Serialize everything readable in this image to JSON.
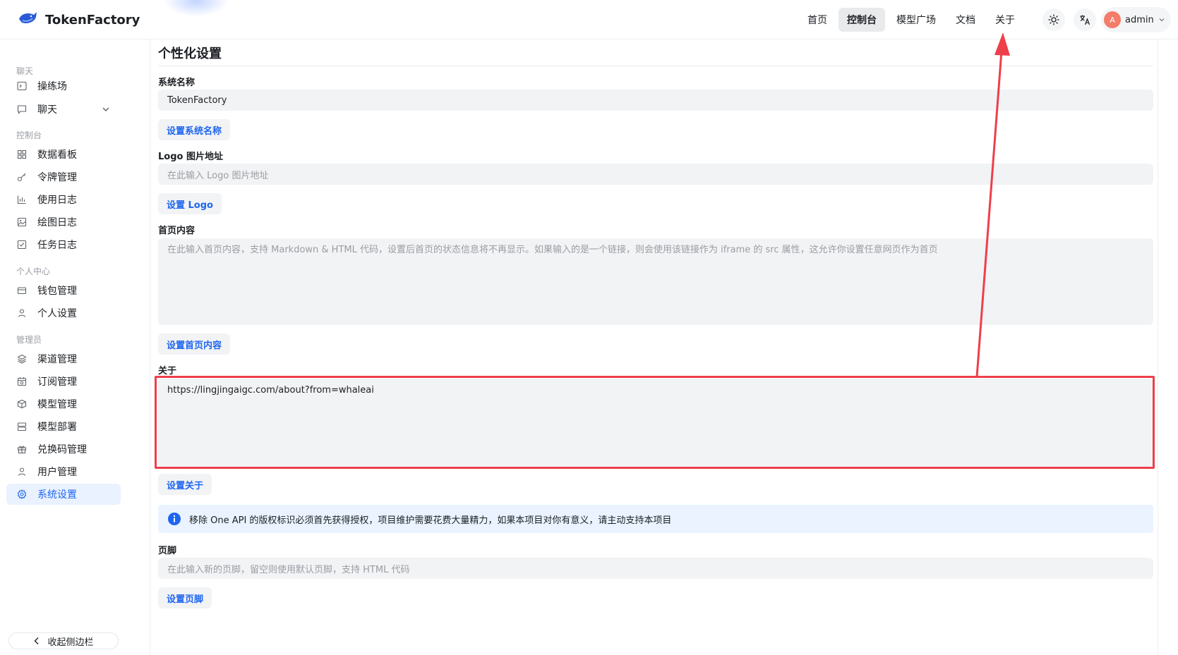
{
  "app": {
    "name": "TokenFactory"
  },
  "nav": {
    "items": [
      {
        "label": "首页"
      },
      {
        "label": "控制台",
        "active": true
      },
      {
        "label": "模型广场"
      },
      {
        "label": "文档"
      },
      {
        "label": "关于"
      }
    ]
  },
  "user": {
    "avatar_letter": "A",
    "name": "admin"
  },
  "sidebar": {
    "sections": [
      {
        "label": "聊天"
      },
      {
        "label": "控制台"
      },
      {
        "label": "个人中心"
      },
      {
        "label": "管理员"
      }
    ],
    "items": [
      {
        "label": "操练场",
        "icon": "terminal-icon"
      },
      {
        "label": "聊天",
        "icon": "chat-icon"
      },
      {
        "label": "数据看板",
        "icon": "dashboard-icon"
      },
      {
        "label": "令牌管理",
        "icon": "key-icon"
      },
      {
        "label": "使用日志",
        "icon": "chart-icon"
      },
      {
        "label": "绘图日志",
        "icon": "image-icon"
      },
      {
        "label": "任务日志",
        "icon": "task-icon"
      },
      {
        "label": "钱包管理",
        "icon": "wallet-icon"
      },
      {
        "label": "个人设置",
        "icon": "user-icon"
      },
      {
        "label": "渠道管理",
        "icon": "layers-icon"
      },
      {
        "label": "订阅管理",
        "icon": "calendar-icon"
      },
      {
        "label": "模型管理",
        "icon": "box-icon"
      },
      {
        "label": "模型部署",
        "icon": "server-icon"
      },
      {
        "label": "兑换码管理",
        "icon": "gift-icon"
      },
      {
        "label": "用户管理",
        "icon": "user-icon"
      },
      {
        "label": "系统设置",
        "icon": "gear-icon",
        "active": true
      }
    ],
    "collapse_label": "收起侧边栏"
  },
  "content": {
    "title": "个性化设置",
    "system_name": {
      "label": "系统名称",
      "value": "TokenFactory",
      "button": "设置系统名称"
    },
    "logo": {
      "label": "Logo 图片地址",
      "placeholder": "在此输入 Logo 图片地址",
      "button": "设置 Logo"
    },
    "home": {
      "label": "首页内容",
      "placeholder": "在此输入首页内容，支持 Markdown & HTML 代码，设置后首页的状态信息将不再显示。如果输入的是一个链接，则会使用该链接作为 iframe 的 src 属性，这允许你设置任意网页作为首页",
      "button": "设置首页内容"
    },
    "about": {
      "label": "关于",
      "value": "https://lingjingaigc.com/about?from=whaleai",
      "button": "设置关于"
    },
    "notice": "移除 One API 的版权标识必须首先获得授权，项目维护需要花费大量精力，如果本项目对你有意义，请主动支持本项目",
    "footer": {
      "label": "页脚",
      "placeholder": "在此输入新的页脚，留空则使用默认页脚，支持 HTML 代码",
      "button": "设置页脚"
    }
  },
  "colors": {
    "accent": "#1f66f0",
    "annotation": "#ee3f4a"
  }
}
